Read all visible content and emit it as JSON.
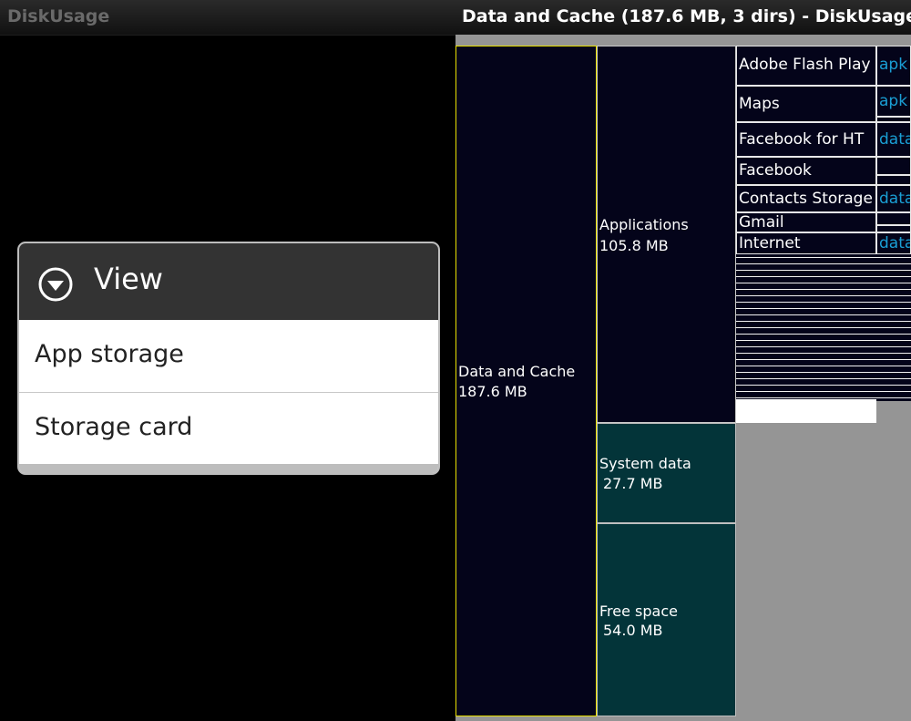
{
  "left_screen": {
    "title": "DiskUsage",
    "dialog": {
      "title": "View",
      "icon": "dropdown-circle-icon",
      "options": [
        {
          "label": "App storage"
        },
        {
          "label": "Storage card"
        }
      ]
    }
  },
  "right_screen": {
    "title": "Data and Cache (187.6 MB, 3 dirs) - DiskUsage",
    "colors": {
      "dir_fill": "#04041a",
      "system_fill": "#033439",
      "selected_border": "#e8e000",
      "sub_label": "#1a9fd5",
      "empty_area": "#959595"
    },
    "blocks": {
      "data_cache": {
        "name": "Data and Cache",
        "size": "187.6 MB"
      },
      "applications": {
        "name": "Applications",
        "size": "105.8 MB"
      },
      "system_data": {
        "name": "System data",
        "size": "27.7 MB"
      },
      "free_space": {
        "name": "Free space",
        "size": "54.0 MB"
      }
    },
    "apps": [
      {
        "name": "Adobe Flash Play",
        "sub": "apk"
      },
      {
        "name": "Maps",
        "sub": "apk"
      },
      {
        "name": "Facebook for HT",
        "sub": "data"
      },
      {
        "name": "Facebook",
        "sub": ""
      },
      {
        "name": "Contacts Storage",
        "sub": "data"
      },
      {
        "name": "Gmail",
        "sub": ""
      },
      {
        "name": "Internet",
        "sub": "data"
      }
    ]
  }
}
